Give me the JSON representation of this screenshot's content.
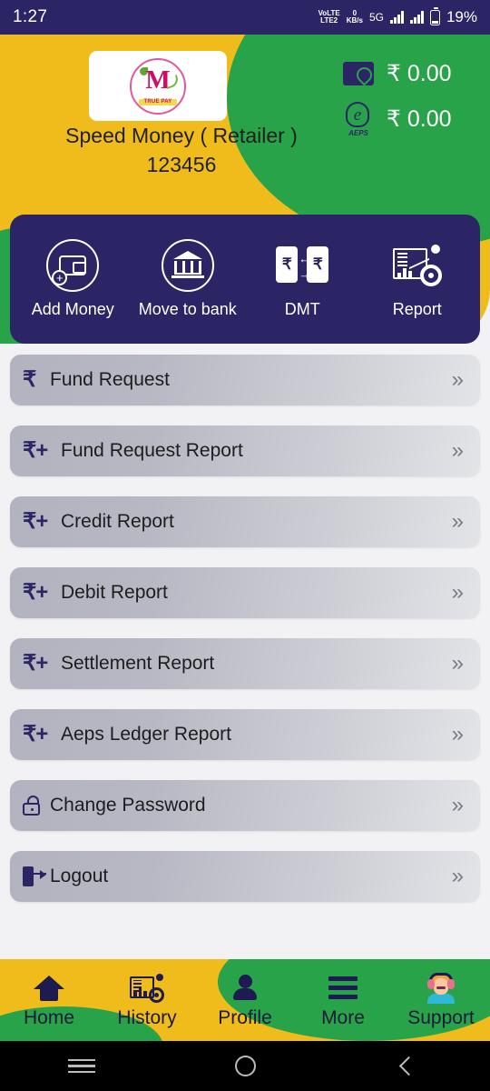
{
  "status_bar": {
    "time": "1:27",
    "volte_line1": "VoLTE",
    "volte_line2": "LTE2",
    "data_rate_value": "0",
    "data_rate_unit": "KB/s",
    "network": "5G",
    "battery_percent": "19%"
  },
  "header": {
    "logo_letter": "M",
    "logo_wordmark": "TRUE PAY",
    "brand_name": "Speed Money ( Retailer )",
    "brand_id": "123456",
    "balances": [
      {
        "icon": "wallet-icon",
        "label": "wallet-balance",
        "amount": "₹ 0.00"
      },
      {
        "icon": "aeps-fingerprint-icon",
        "label": "aeps-balance",
        "amount": "₹ 0.00",
        "badge": "AEPS"
      }
    ]
  },
  "quick_actions": [
    {
      "id": "add-money",
      "label": "Add Money",
      "icon": "wallet-plus-icon"
    },
    {
      "id": "move-to-bank",
      "label": "Move to bank",
      "icon": "bank-icon"
    },
    {
      "id": "dmt",
      "label": "DMT",
      "icon": "money-transfer-icon"
    },
    {
      "id": "report",
      "label": "Report",
      "icon": "report-chart-icon"
    }
  ],
  "menu_items": [
    {
      "id": "fund-request",
      "label": "Fund Request",
      "icon": "rupee-icon",
      "glyph": "₹"
    },
    {
      "id": "fund-request-report",
      "label": "Fund Request Report",
      "icon": "rupee-plus-icon",
      "glyph": "₹+"
    },
    {
      "id": "credit-report",
      "label": "Credit Report",
      "icon": "rupee-plus-icon",
      "glyph": "₹+"
    },
    {
      "id": "debit-report",
      "label": "Debit Report",
      "icon": "rupee-plus-icon",
      "glyph": "₹+"
    },
    {
      "id": "settlement-report",
      "label": "Settlement Report",
      "icon": "rupee-plus-icon",
      "glyph": "₹+"
    },
    {
      "id": "aeps-ledger-report",
      "label": "Aeps Ledger Report",
      "icon": "rupee-plus-icon",
      "glyph": "₹+"
    },
    {
      "id": "change-password",
      "label": "Change Password",
      "icon": "unlock-icon",
      "glyph": ""
    },
    {
      "id": "logout",
      "label": "Logout",
      "icon": "logout-icon",
      "glyph": ""
    }
  ],
  "chevron": "»",
  "bottom_nav": [
    {
      "id": "home",
      "label": "Home",
      "icon": "home-icon"
    },
    {
      "id": "history",
      "label": "History",
      "icon": "history-chart-icon"
    },
    {
      "id": "profile",
      "label": "Profile",
      "icon": "person-icon"
    },
    {
      "id": "more",
      "label": "More",
      "icon": "hamburger-icon"
    },
    {
      "id": "support",
      "label": "Support",
      "icon": "support-agent-icon"
    }
  ],
  "android_nav": [
    {
      "id": "recents",
      "icon": "recents-menu-icon"
    },
    {
      "id": "home",
      "icon": "home-circle-icon"
    },
    {
      "id": "back",
      "icon": "back-chevron-icon"
    }
  ],
  "colors": {
    "navy": "#2b2566",
    "yellow": "#efbc1c",
    "green": "#29a349",
    "page_bg": "#f2f2f4",
    "logo_pink": "#c8106a"
  }
}
